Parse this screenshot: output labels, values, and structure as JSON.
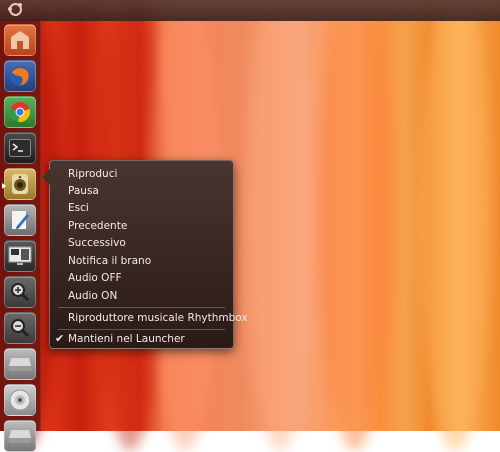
{
  "panel": {
    "logo_icon": "ubuntu-logo-icon"
  },
  "launcher": {
    "items": [
      {
        "name": "home-folder",
        "icon": "home-folder-icon",
        "color": "#d65a2a"
      },
      {
        "name": "firefox",
        "icon": "firefox-icon",
        "color": "#2f5aa8"
      },
      {
        "name": "chromium",
        "icon": "chrome-icon",
        "color": "#3a9a35"
      },
      {
        "name": "terminal",
        "icon": "terminal-icon",
        "color": "#2b2b2b"
      },
      {
        "name": "rhythmbox",
        "icon": "speaker-icon",
        "color": "#c9a54a"
      },
      {
        "name": "text-editor",
        "icon": "pencil-icon",
        "color": "#8a8a8a"
      },
      {
        "name": "system-monitor",
        "icon": "monitor-icon",
        "color": "#3a3a3a"
      },
      {
        "name": "zoom-in",
        "icon": "magnifier-plus-icon",
        "color": "#5c5c5c"
      },
      {
        "name": "zoom-out",
        "icon": "magnifier-minus-icon",
        "color": "#5c5c5c"
      },
      {
        "name": "drive",
        "icon": "hard-drive-icon",
        "color": "#9a9a9a"
      },
      {
        "name": "cd-drive",
        "icon": "disc-icon",
        "color": "#bdbdbd"
      },
      {
        "name": "drive-2",
        "icon": "hard-drive-icon",
        "color": "#9a9a9a"
      }
    ]
  },
  "quicklist": {
    "items": [
      "Riproduci",
      "Pausa",
      "Esci",
      "Precedente",
      "Successivo",
      "Notifica il brano",
      "Audio OFF",
      "Audio ON"
    ],
    "app_title": "Riproduttore musicale Rhythmbox",
    "keep_in_launcher": "Mantieni nel Launcher",
    "keep_checked": true
  }
}
